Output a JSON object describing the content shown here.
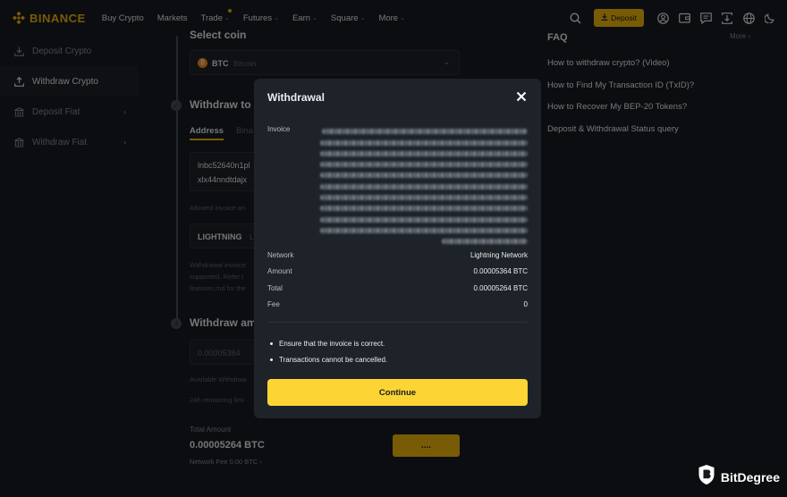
{
  "nav": {
    "logo": "BINANCE",
    "items": [
      {
        "label": "Buy Crypto",
        "chevron": false
      },
      {
        "label": "Markets",
        "chevron": false
      },
      {
        "label": "Trade",
        "chevron": true
      },
      {
        "label": "Futures",
        "chevron": true
      },
      {
        "label": "Earn",
        "chevron": true
      },
      {
        "label": "Square",
        "chevron": true
      },
      {
        "label": "More",
        "chevron": true
      }
    ],
    "deposit_label": "Deposit"
  },
  "sidebar": {
    "items": [
      {
        "label": "Deposit Crypto"
      },
      {
        "label": "Withdraw Crypto"
      },
      {
        "label": "Deposit Fiat"
      },
      {
        "label": "Withdraw Fiat"
      }
    ]
  },
  "main": {
    "step1_title": "Select coin",
    "coin_symbol": "BTC",
    "coin_name": "Bitcoin",
    "step2_title": "Withdraw to",
    "tab_address": "Address",
    "tab_binance": "Bina",
    "address_line1": "lnbc52640n1pl",
    "address_line2": "xlx44nndtdajx",
    "allowed_text": "Allowed invoice an",
    "network_label": "LIGHTNING",
    "network_suffix": "Li",
    "note_line1": "Withdrawal invoice",
    "note_line2": "supported. Refer t",
    "note_line3": "features.md for the",
    "step3_title": "Withdraw am",
    "amount_value": "0.00005364",
    "available_text": "Available Withdraw",
    "remaining_text": "24h remaining limi",
    "total_label": "Total Amount",
    "total_value": "0.00005264 BTC",
    "fee_text": "Network Fee 0.00 BTC",
    "withdraw_btn": "...."
  },
  "faq": {
    "title": "FAQ",
    "more": "More",
    "links": [
      "How to withdraw crypto? (Video)",
      "How to Find My Transaction ID (TxID)?",
      "How to Recover My BEP-20 Tokens?",
      "Deposit & Withdrawal Status query"
    ]
  },
  "modal": {
    "title": "Withdrawal",
    "invoice_label": "Invoice",
    "rows": [
      {
        "key": "Network",
        "value": "Lightning Network"
      },
      {
        "key": "Amount",
        "value": "0.00005364 BTC"
      },
      {
        "key": "Total",
        "value": "0.00005264 BTC"
      },
      {
        "key": "Fee",
        "value": "0"
      }
    ],
    "notes": [
      "Ensure that the invoice is correct.",
      "Transactions cannot be cancelled."
    ],
    "continue_label": "Continue"
  },
  "watermark": {
    "text": "BitDegree"
  },
  "colors": {
    "brand": "#f0b90b",
    "button": "#fcd535",
    "bg": "#181a20",
    "modal_bg": "#1e2329"
  }
}
